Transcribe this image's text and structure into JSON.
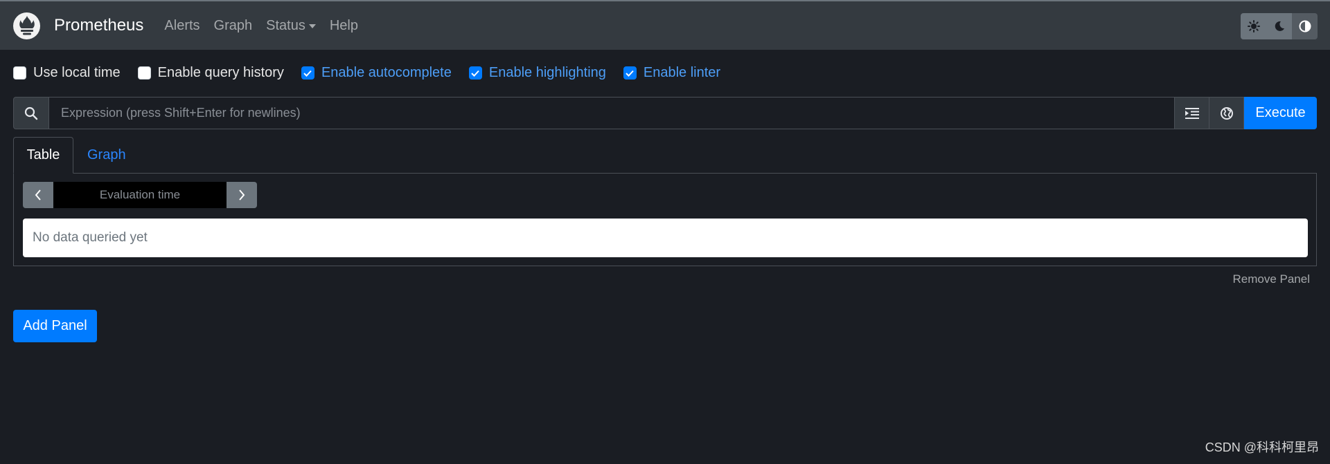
{
  "navbar": {
    "brand": "Prometheus",
    "links": [
      {
        "label": "Alerts"
      },
      {
        "label": "Graph"
      },
      {
        "label": "Status"
      },
      {
        "label": "Help"
      }
    ],
    "theme_buttons": [
      "sun-icon",
      "moon-icon",
      "half-circle-icon"
    ]
  },
  "options": [
    {
      "label": "Use local time",
      "checked": false
    },
    {
      "label": "Enable query history",
      "checked": false
    },
    {
      "label": "Enable autocomplete",
      "checked": true
    },
    {
      "label": "Enable highlighting",
      "checked": true
    },
    {
      "label": "Enable linter",
      "checked": true
    }
  ],
  "query": {
    "placeholder": "Expression (press Shift+Enter for newlines)",
    "value": "",
    "execute_label": "Execute"
  },
  "tabs": [
    {
      "label": "Table",
      "active": true
    },
    {
      "label": "Graph",
      "active": false
    }
  ],
  "panel": {
    "eval_placeholder": "Evaluation time",
    "no_data": "No data queried yet",
    "remove_label": "Remove Panel"
  },
  "add_panel_label": "Add Panel",
  "watermark": "CSDN @科科柯里昂",
  "colors": {
    "accent": "#007bff",
    "navbar": "#343a40",
    "background": "#1a1d23"
  }
}
